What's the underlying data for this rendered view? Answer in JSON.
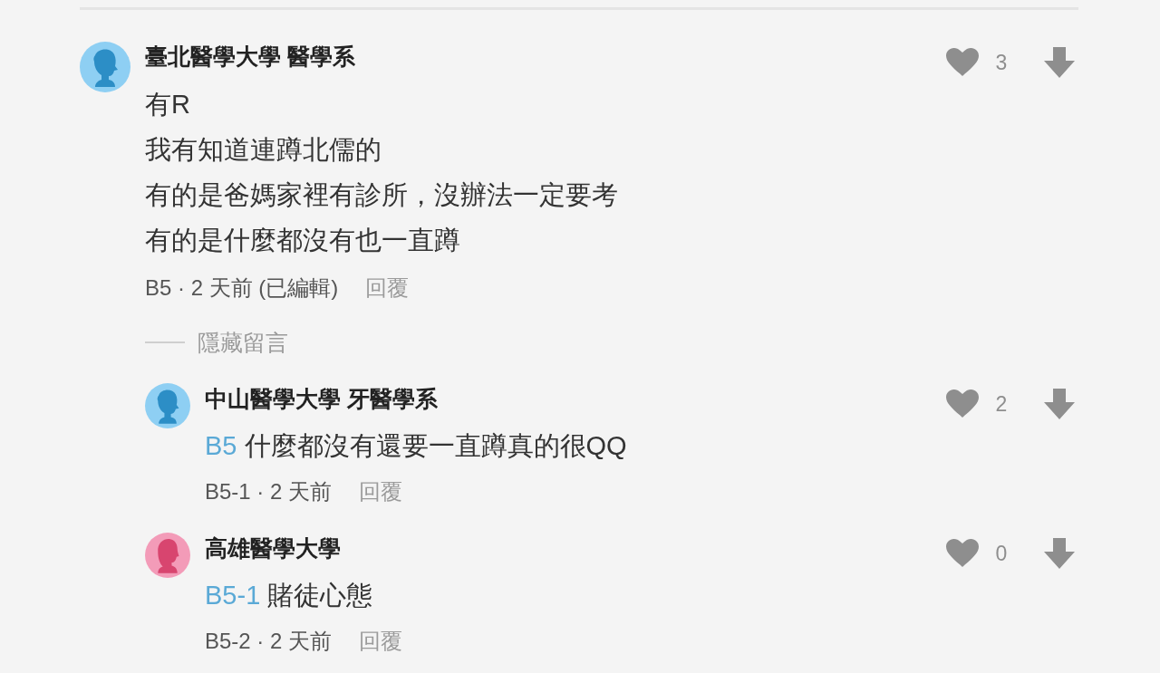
{
  "comments": [
    {
      "author": "臺北醫學大學 醫學系",
      "avatar": {
        "kind": "male",
        "color": "#8ecff3"
      },
      "lines": [
        "有R",
        "我有知道連蹲北儒的",
        "有的是爸媽家裡有診所，沒辦法一定要考",
        "有的是什麼都沒有也一直蹲"
      ],
      "meta": "B5 · 2 天前 (已編輯)",
      "reply_label": "回覆",
      "likes": "3",
      "replies_toggle": "隱藏留言",
      "replies": [
        {
          "author": "中山醫學大學 牙醫學系",
          "avatar": {
            "kind": "male",
            "color": "#8ecff3"
          },
          "mention": "B5",
          "text": "什麼都沒有還要一直蹲真的很QQ",
          "meta": "B5-1 · 2 天前",
          "reply_label": "回覆",
          "likes": "2"
        },
        {
          "author": "高雄醫學大學",
          "avatar": {
            "kind": "female",
            "color": "#f39bb8"
          },
          "mention": "B5-1",
          "text": "賭徒心態",
          "meta": "B5-2 · 2 天前",
          "reply_label": "回覆",
          "likes": "0"
        }
      ]
    }
  ]
}
